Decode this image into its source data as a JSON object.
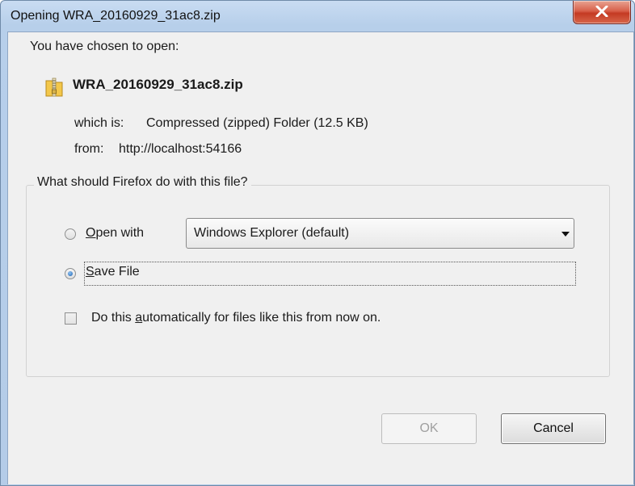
{
  "window": {
    "title": "Opening WRA_20160929_31ac8.zip",
    "close_glyph": "x"
  },
  "dialog": {
    "intro": "You have chosen to open:",
    "file_icon": "zip-folder-icon",
    "filename": "WRA_20160929_31ac8.zip",
    "which_is_label": "which is:",
    "which_is_value": "Compressed (zipped) Folder (12.5 KB)",
    "from_label": "from:",
    "from_value": "http://localhost:54166"
  },
  "action_group": {
    "legend": "What should Firefox do with this file?",
    "open_with": {
      "mnemonic": "O",
      "rest": "pen with",
      "selected": false,
      "app_select_value": "Windows Explorer (default)"
    },
    "save_file": {
      "mnemonic": "S",
      "rest": "ave File",
      "selected": true
    },
    "auto_checkbox": {
      "before": "Do this ",
      "mnemonic": "a",
      "after": "utomatically for files like this from now on.",
      "checked": false
    }
  },
  "buttons": {
    "ok": "OK",
    "cancel": "Cancel"
  },
  "colors": {
    "titlebar": "#b7cfea",
    "client_bg": "#f0f0f0",
    "close_button": "#c43a23",
    "radio_selected": "#1b5fae"
  }
}
